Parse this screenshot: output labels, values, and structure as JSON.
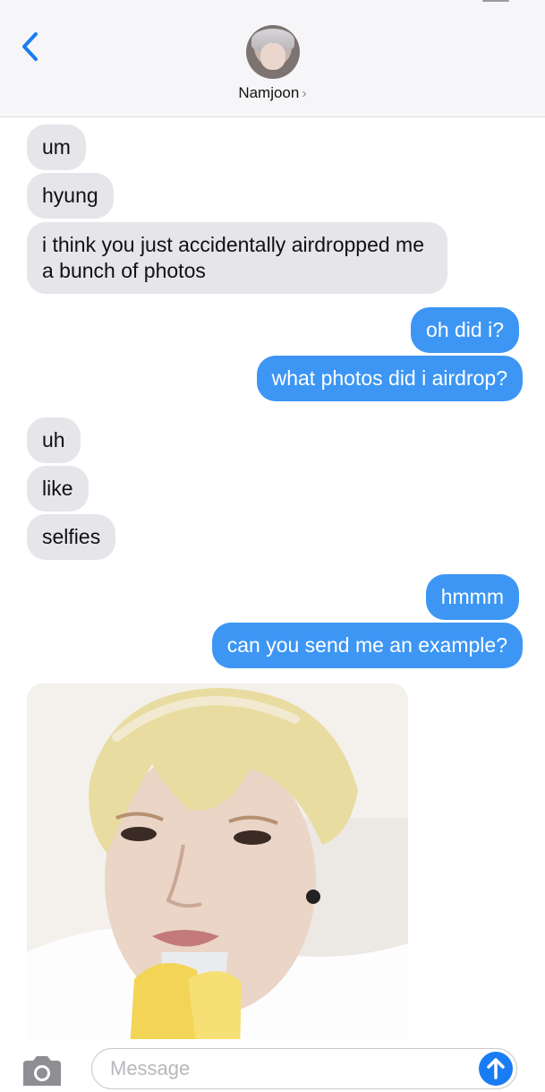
{
  "header": {
    "contact_name": "Namjoon",
    "chevron": "›",
    "back_icon": "chevron-left-icon"
  },
  "colors": {
    "incoming_bubble": "#e5e5ea",
    "outgoing_bubble": "#3d96f3",
    "accent": "#1a7cf2"
  },
  "messages": [
    {
      "sender": "them",
      "text": "um"
    },
    {
      "sender": "them",
      "text": "hyung"
    },
    {
      "sender": "them",
      "text": "i think you just accidentally airdropped me a bunch of photos"
    },
    {
      "sender": "me",
      "text": "oh did i?"
    },
    {
      "sender": "me",
      "text": "what photos did i airdrop?"
    },
    {
      "sender": "them",
      "text": "uh"
    },
    {
      "sender": "them",
      "text": "like"
    },
    {
      "sender": "them",
      "text": "selfies"
    },
    {
      "sender": "me",
      "text": "hmmm"
    },
    {
      "sender": "me",
      "text": "can you send me an example?"
    },
    {
      "sender": "them",
      "type": "photo"
    }
  ],
  "composer": {
    "placeholder": "Message",
    "camera_icon": "camera-icon",
    "send_icon": "arrow-up-icon"
  }
}
